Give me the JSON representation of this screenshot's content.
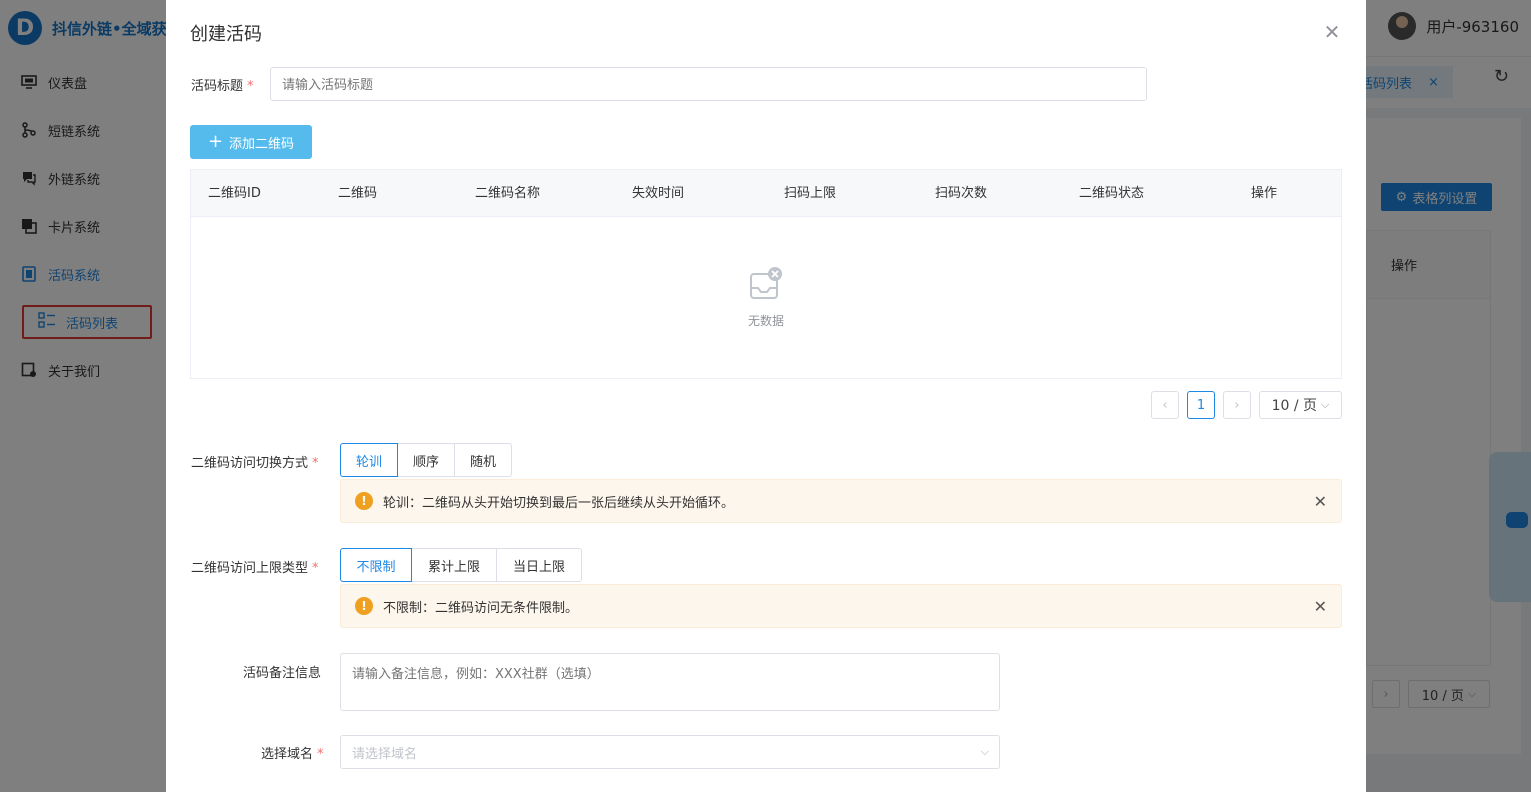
{
  "app": {
    "logo_letter": "D",
    "logo_text": "抖信外链•全域获",
    "user_name": "用户-963160"
  },
  "sidebar": {
    "items": [
      {
        "label": "仪表盘",
        "icon": "monitor-icon"
      },
      {
        "label": "短链系统",
        "icon": "link-nodes-icon"
      },
      {
        "label": "外链系统",
        "icon": "chat-icon"
      },
      {
        "label": "卡片系统",
        "icon": "cards-icon"
      },
      {
        "label": "活码系统",
        "icon": "qrcode-system-icon"
      },
      {
        "label": "关于我们",
        "icon": "about-icon"
      }
    ],
    "sub_item": {
      "label": "活码列表",
      "icon": "list-icon"
    }
  },
  "background": {
    "tab_label": "活码列表",
    "settings_button": "表格列设置",
    "table_op_header": "操作",
    "page_size": "10 / 页"
  },
  "dialog": {
    "title": "创建活码",
    "title_field": {
      "label": "活码标题",
      "placeholder": "请输入活码标题"
    },
    "add_button": "添加二维码",
    "table": {
      "headers": [
        "二维码ID",
        "二维码",
        "二维码名称",
        "失效时间",
        "扫码上限",
        "扫码次数",
        "二维码状态",
        "操作"
      ],
      "empty_text": "无数据"
    },
    "pagination": {
      "current_page": "1",
      "page_size": "10 / 页"
    },
    "switch_mode": {
      "label": "二维码访问切换方式",
      "options": [
        "轮训",
        "顺序",
        "随机"
      ],
      "selected": "轮训",
      "tip": "轮训：二维码从头开始切换到最后一张后继续从头开始循环。"
    },
    "limit_type": {
      "label": "二维码访问上限类型",
      "options": [
        "不限制",
        "累计上限",
        "当日上限"
      ],
      "selected": "不限制",
      "tip": "不限制：二维码访问无条件限制。"
    },
    "remark": {
      "label": "活码备注信息",
      "placeholder": "请输入备注信息，例如：XXX社群（选填）"
    },
    "domain": {
      "label": "选择域名",
      "placeholder": "请选择域名"
    }
  },
  "colors": {
    "primary": "#1e88e5",
    "add_button": "#55bbed",
    "required": "#f56c6c",
    "warning": "#f0a020",
    "warning_bg": "#fdf6ec",
    "highlight_box": "#e53935"
  }
}
